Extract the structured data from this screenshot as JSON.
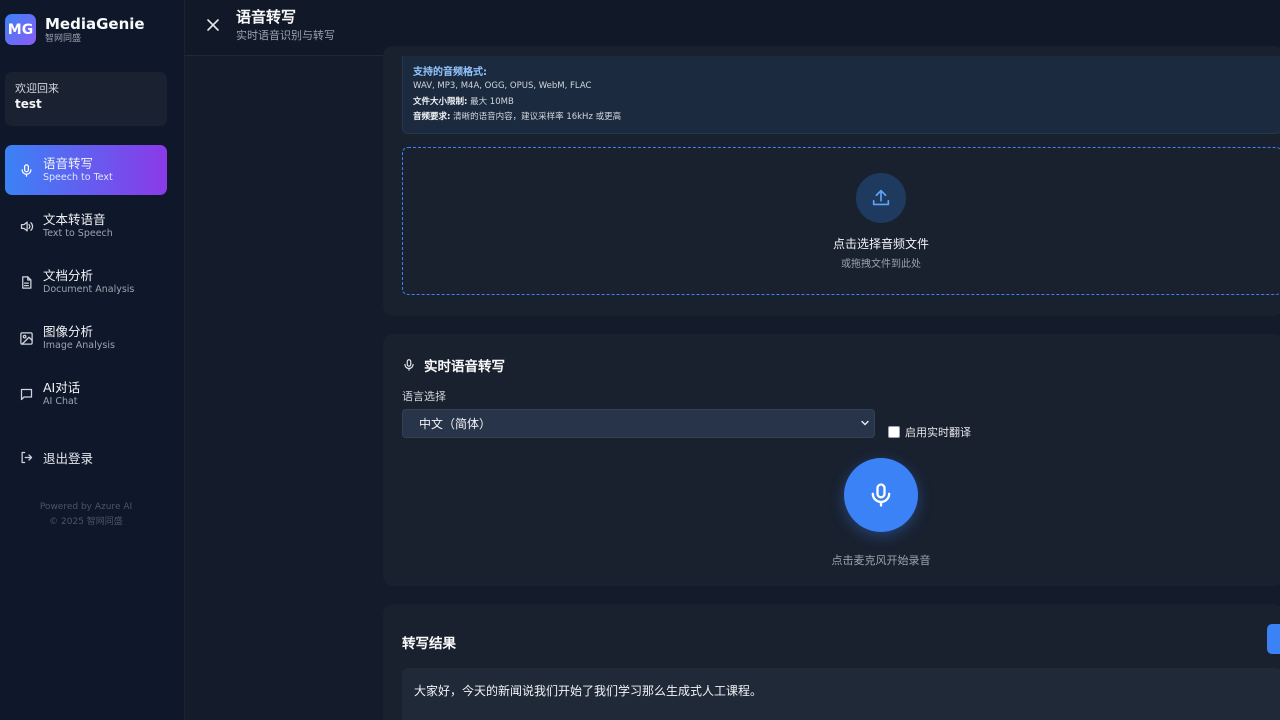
{
  "brand": {
    "logo_text": "MG",
    "name": "MediaGenie",
    "subtitle": "智网同盛"
  },
  "welcome": {
    "label": "欢迎回来",
    "user": "test"
  },
  "nav": [
    {
      "title": "语音转写",
      "subtitle": "Speech to Text",
      "icon": "microphone-icon",
      "active": true
    },
    {
      "title": "文本转语音",
      "subtitle": "Text to Speech",
      "icon": "speaker-icon",
      "active": false
    },
    {
      "title": "文档分析",
      "subtitle": "Document Analysis",
      "icon": "document-icon",
      "active": false
    },
    {
      "title": "图像分析",
      "subtitle": "Image Analysis",
      "icon": "image-icon",
      "active": false
    },
    {
      "title": "AI对话",
      "subtitle": "AI Chat",
      "icon": "chat-icon",
      "active": false
    }
  ],
  "logout": {
    "label": "退出登录",
    "icon": "logout-icon"
  },
  "footer": {
    "powered": "Powered by Azure AI",
    "copyright": "© 2025 智网同盛"
  },
  "header": {
    "title": "语音转写",
    "subtitle": "实时语音识别与转写",
    "close_icon": "close-icon"
  },
  "upload": {
    "formats_title": "支持的音频格式:",
    "formats": "WAV, MP3, M4A, OGG, OPUS, WebM, FLAC",
    "size_label": "文件大小限制:",
    "size_value": "最大 10MB",
    "quality_label": "音频要求:",
    "quality_value": "清晰的语音内容，建议采样率 16kHz 或更高",
    "drop_title": "点击选择音频文件",
    "drop_subtitle": "或拖拽文件到此处",
    "icon": "upload-icon"
  },
  "realtime": {
    "title": "实时语音转写",
    "language_label": "语言选择",
    "language_value": "中文（简体）",
    "translate_label": "启用实时翻译",
    "translate_checked": false,
    "mic_hint": "点击麦克风开始录音"
  },
  "result": {
    "title": "转写结果",
    "text": "大家好，今天的新闻说我们开始了我们学习那么生成式人工课程。"
  },
  "colors": {
    "accent": "#3b82f6",
    "accent_gradient_end": "#8b3ae8",
    "background": "#111827"
  }
}
